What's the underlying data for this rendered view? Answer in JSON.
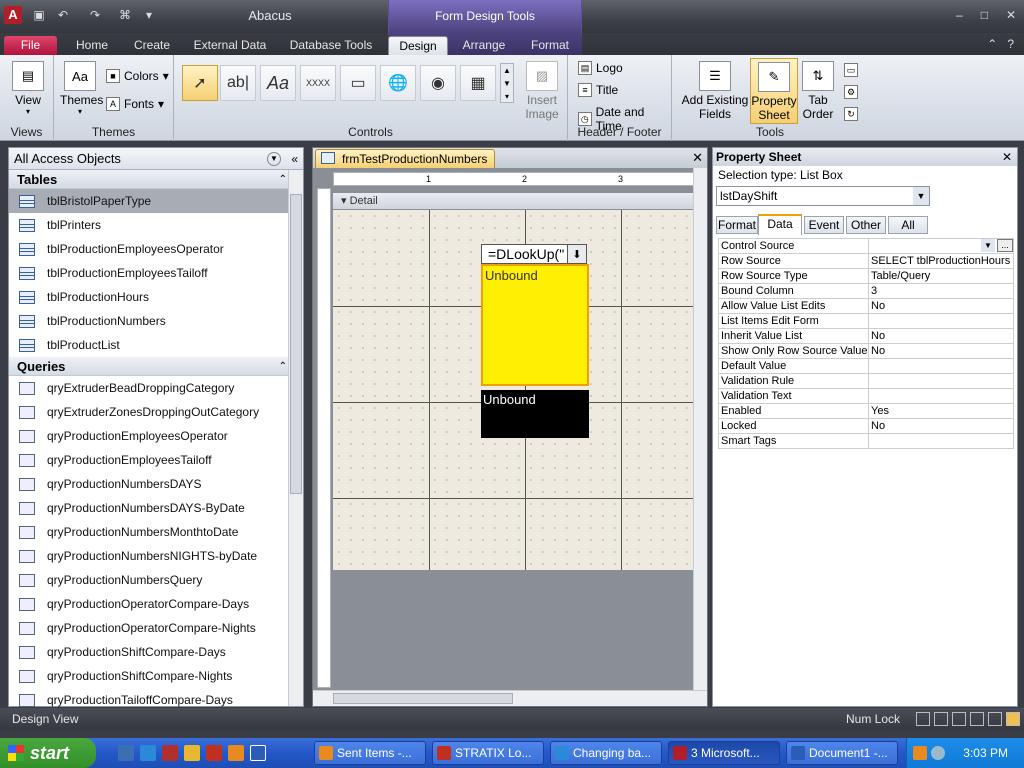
{
  "app": {
    "logo": "A",
    "title": "Abacus",
    "context_title": "Form Design Tools"
  },
  "window_controls": [
    "–",
    "□",
    "✕"
  ],
  "ribbon_tabs": [
    "File",
    "Home",
    "Create",
    "External Data",
    "Database Tools",
    "Design",
    "Arrange",
    "Format"
  ],
  "ribbon": {
    "views": {
      "view_label": "View",
      "group": "Views"
    },
    "themes": {
      "themes_label": "Themes",
      "colors_label": "Colors",
      "fonts_label": "Fonts",
      "group": "Themes"
    },
    "controls": {
      "group": "Controls",
      "insert_image": "Insert Image",
      "label_icon": "Aa",
      "textbox_icon": "ab|",
      "button_icon": "XXXX"
    },
    "header_footer": {
      "logo": "Logo",
      "title": "Title",
      "date_time": "Date and Time",
      "group": "Header / Footer"
    },
    "tools": {
      "add_existing_fields": "Add Existing Fields",
      "property_sheet": "Property Sheet",
      "tab_order": "Tab Order",
      "group": "Tools"
    }
  },
  "nav": {
    "header": "All Access Objects",
    "tables_label": "Tables",
    "tables": [
      "tblBristolPaperType",
      "tblPrinters",
      "tblProductionEmployeesOperator",
      "tblProductionEmployeesTailoff",
      "tblProductionHours",
      "tblProductionNumbers",
      "tblProductList"
    ],
    "selected_table": "tblBristolPaperType",
    "queries_label": "Queries",
    "queries": [
      "qryExtruderBeadDroppingCategory",
      "qryExtruderZonesDroppingOutCategory",
      "qryProductionEmployeesOperator",
      "qryProductionEmployeesTailoff",
      "qryProductionNumbersDAYS",
      "qryProductionNumbersDAYS-ByDate",
      "qryProductionNumbersMonthtoDate",
      "qryProductionNumbersNIGHTS-byDate",
      "qryProductionNumbersQuery",
      "qryProductionOperatorCompare-Days",
      "qryProductionOperatorCompare-Nights",
      "qryProductionShiftCompare-Days",
      "qryProductionShiftCompare-Nights",
      "qryProductionTailoffCompare-Days"
    ]
  },
  "form": {
    "tab_title": "frmTestProductionNumbers",
    "ruler_marks": [
      "1",
      "2",
      "3"
    ],
    "detail_label": "Detail",
    "combo_text": "=DLookUp(\"",
    "listbox_text": "Unbound",
    "textbox_text": "Unbound"
  },
  "props": {
    "title": "Property Sheet",
    "selection_type": "Selection type:  List Box",
    "selected_control": "lstDayShift",
    "tabs": [
      "Format",
      "Data",
      "Event",
      "Other",
      "All"
    ],
    "active_tab": "Data",
    "rows": [
      {
        "name": "Control Source",
        "value": ""
      },
      {
        "name": "Row Source",
        "value": "SELECT tblProductionHours"
      },
      {
        "name": "Row Source Type",
        "value": "Table/Query"
      },
      {
        "name": "Bound Column",
        "value": "3"
      },
      {
        "name": "Allow Value List Edits",
        "value": "No"
      },
      {
        "name": "List Items Edit Form",
        "value": ""
      },
      {
        "name": "Inherit Value List",
        "value": "No"
      },
      {
        "name": "Show Only Row Source Values",
        "value": "No"
      },
      {
        "name": "Default Value",
        "value": ""
      },
      {
        "name": "Validation Rule",
        "value": ""
      },
      {
        "name": "Validation Text",
        "value": ""
      },
      {
        "name": "Enabled",
        "value": "Yes"
      },
      {
        "name": "Locked",
        "value": "No"
      },
      {
        "name": "Smart Tags",
        "value": ""
      }
    ]
  },
  "status": {
    "left": "Design View",
    "right": "Num Lock"
  },
  "taskbar": {
    "start": "start",
    "tasks": [
      "Sent Items -...",
      "STRATIX Lo...",
      "Changing ba...",
      "3 Microsoft...",
      "Document1 -..."
    ],
    "clock": "3:03 PM"
  },
  "colors": {
    "listbox_fill": "#ffef00",
    "selection_border": "#f0a000",
    "file_tab": "#c0164a"
  }
}
